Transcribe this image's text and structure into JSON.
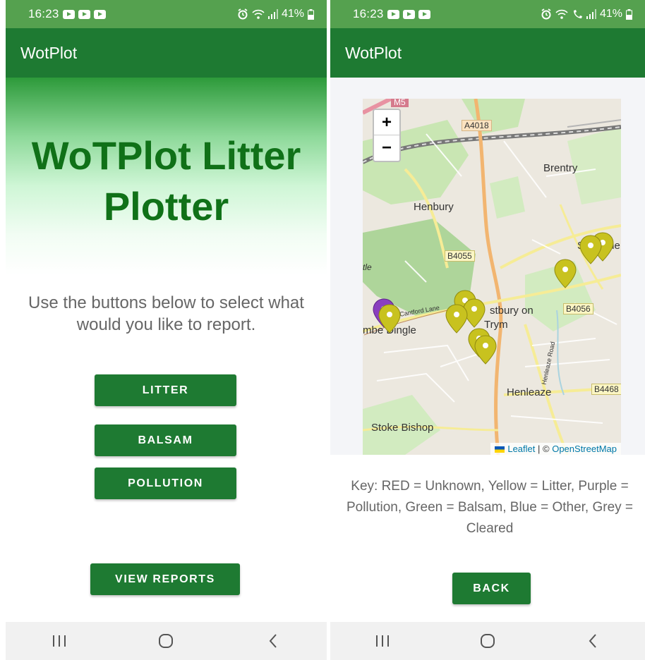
{
  "left": {
    "status": {
      "time": "16:23",
      "battery": "41%"
    },
    "app_title": "WotPlot",
    "hero_title": "WoTPlot Litter Plotter",
    "instructions": "Use the buttons below to select what would you like to report.",
    "buttons": {
      "litter": "LITTER",
      "balsam": "BALSAM",
      "pollution": "POLLUTION",
      "view_reports": "VIEW REPORTS"
    }
  },
  "right": {
    "status": {
      "time": "16:23",
      "battery": "41%"
    },
    "app_title": "WotPlot",
    "map": {
      "zoom_in": "+",
      "zoom_out": "−",
      "labels": {
        "m5": "M5",
        "a4018": "A4018",
        "brentry": "Brentry",
        "henbury": "Henbury",
        "b4055": "B4055",
        "cantford_lane": "Cantford Lane",
        "westbury": "stbury on",
        "trym": "Trym",
        "b4056": "B4056",
        "combe_dingle": "mbe Dingle",
        "henleaze_road": "Henleaze Road",
        "henleaze": "Henleaze",
        "b4468": "B4468",
        "stoke_bishop": "Stoke Bishop",
        "southmead": "S",
        "southmead_end": "me",
        "tle": "tle"
      },
      "attribution": {
        "leaflet": "Leaflet",
        "separator": "| ©",
        "osm": "OpenStreetMap"
      },
      "marker_colors": {
        "litter": "#c8c21f",
        "pollution": "#8a3fbf"
      }
    },
    "key_text": "Key: RED = Unknown, Yellow = Litter, Purple = Pollution, Green = Balsam, Blue = Other, Grey = Cleared",
    "back_button": "BACK"
  }
}
